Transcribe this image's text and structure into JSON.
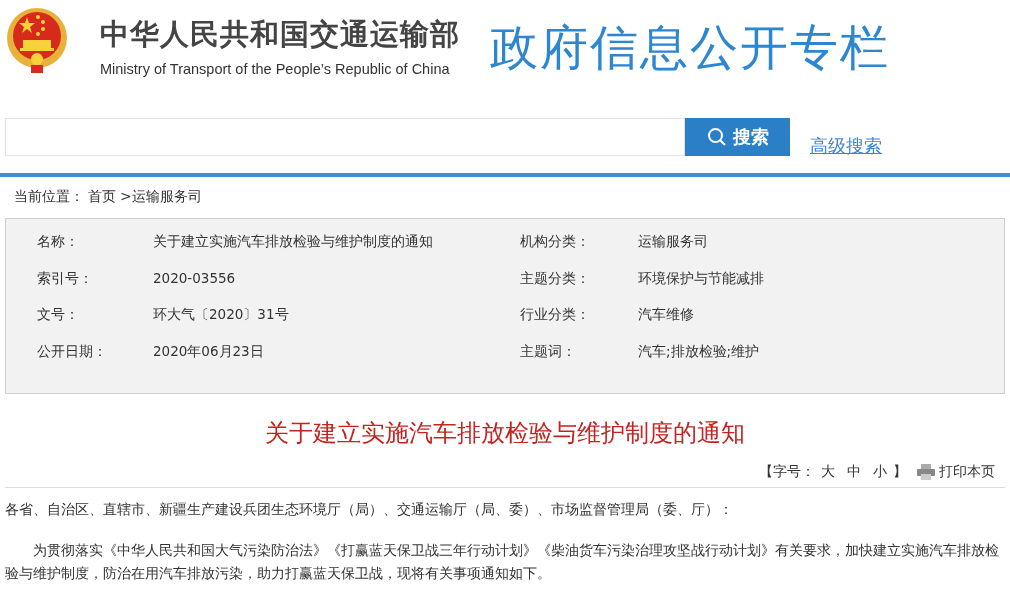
{
  "header": {
    "title_cn": "中华人民共和国交通运输部",
    "title_en": "Ministry of Transport of the People’s Republic of China",
    "banner": "政府信息公开专栏"
  },
  "search": {
    "button": "搜索",
    "advanced_link": "高级搜索"
  },
  "breadcrumb": {
    "label": "当前位置：",
    "items": [
      "首页",
      ">运输服务司"
    ]
  },
  "meta": [
    [
      {
        "label": "名称：",
        "value": "关于建立实施汽车排放检验与维护制度的通知"
      },
      {
        "label": "机构分类：",
        "value": "运输服务司"
      }
    ],
    [
      {
        "label": "索引号：",
        "value": "2020-03556"
      },
      {
        "label": "主题分类：",
        "value": "环境保护与节能减排"
      }
    ],
    [
      {
        "label": "文号：",
        "value": "环大气〔2020〕31号"
      },
      {
        "label": "行业分类：",
        "value": "汽车维修"
      }
    ],
    [
      {
        "label": "公开日期：",
        "value": "2020年06月23日"
      },
      {
        "label": "主题词：",
        "value": "汽车;排放检验;维护"
      }
    ]
  ],
  "article": {
    "title": "关于建立实施汽车排放检验与维护制度的通知",
    "font_size": {
      "prefix": "【字号：",
      "options": [
        "大",
        "中",
        "小"
      ],
      "suffix": "】"
    },
    "print": "打印本页",
    "paragraphs": [
      {
        "kind": "salutation",
        "text": "各省、自治区、直辖市、新疆生产建设兵团生态环境厅（局）、交通运输厅（局、委）、市场监督管理局（委、厅）："
      },
      {
        "kind": "body",
        "text": "为贯彻落实《中华人民共和国大气污染防治法》《打赢蓝天保卫战三年行动计划》《柴油货车污染治理攻坚战行动计划》有关要求，加快建立实施汽车排放检验与维护制度，防治在用汽车排放污染，助力打赢蓝天保卫战，现将有关事项通知如下。"
      }
    ]
  }
}
